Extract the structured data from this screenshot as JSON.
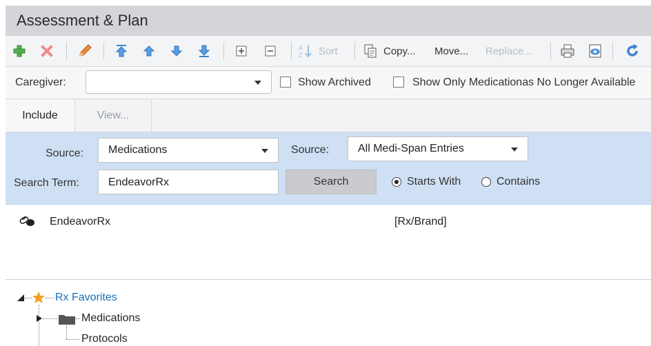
{
  "window": {
    "title": "Assessment & Plan"
  },
  "toolbar": {
    "sort_label": "Sort",
    "copy_label": "Copy...",
    "move_label": "Move...",
    "replace_label": "Replace..."
  },
  "caregiver": {
    "label": "Caregiver:",
    "value": "",
    "show_archived_label": "Show Archived",
    "show_archived_checked": false,
    "show_no_longer_label": "Show Only Medicationas No Longer Available",
    "show_no_longer_checked": false
  },
  "tabs": [
    {
      "label": "Include",
      "active": true
    },
    {
      "label": "View...",
      "active": false
    }
  ],
  "search": {
    "source1_label": "Source:",
    "source1_value": "Medications",
    "source2_label": "Source:",
    "source2_value": "All Medi-Span Entries",
    "term_label": "Search Term:",
    "term_value": "EndeavorRx",
    "search_button": "Search",
    "starts_with_label": "Starts With",
    "contains_label": "Contains",
    "mode": "starts_with"
  },
  "results": [
    {
      "name": "EndeavorRx",
      "type": "[Rx/Brand]",
      "icon": "pill-capsule-icon"
    }
  ],
  "tree": {
    "root": {
      "label": "Rx Favorites",
      "color": "#1a6fb5",
      "icon": "star-icon"
    },
    "children": [
      {
        "label": "Medications",
        "icon": "folder-icon",
        "expandable": true
      },
      {
        "label": "Protocols",
        "icon": "",
        "expandable": false
      }
    ]
  },
  "colors": {
    "accent_blue": "#3a86d1",
    "search_panel_bg": "#cfe0f4",
    "add_green": "#4caf50",
    "delete_red": "#e06a6a",
    "star_orange": "#f0a020"
  }
}
